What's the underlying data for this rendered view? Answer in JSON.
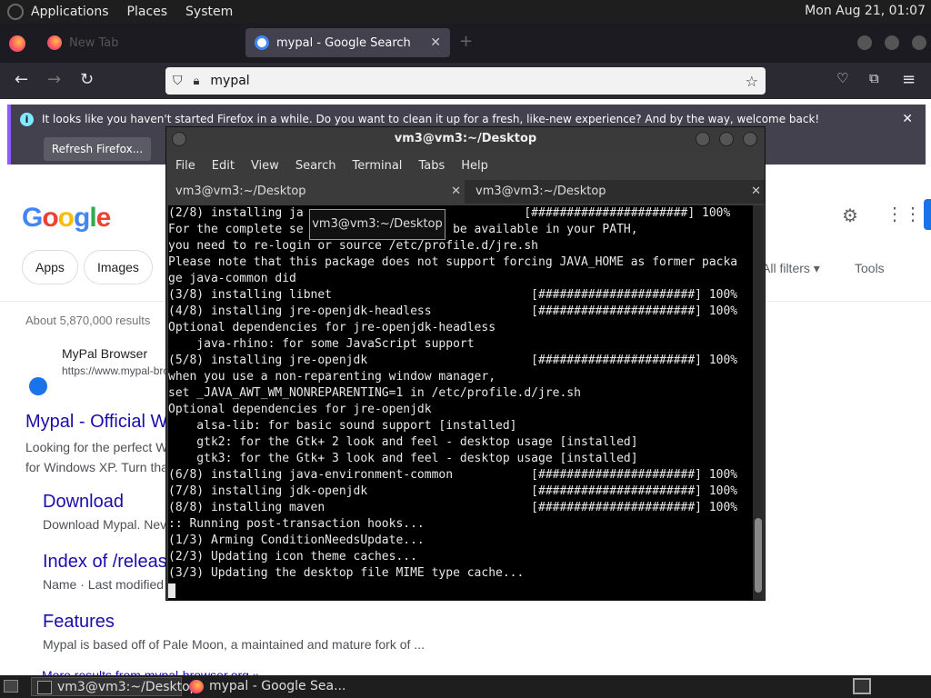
{
  "top_panel": {
    "menus": [
      "Applications",
      "Places",
      "System"
    ],
    "clock": "Mon Aug 21, 01:07"
  },
  "firefox": {
    "tabs": [
      {
        "label": "New Tab",
        "active": false
      },
      {
        "label": "mypal - Google Search",
        "active": true
      }
    ],
    "url": "mypal",
    "notification": {
      "message": "It looks like you haven't started Firefox in a while. Do you want to clean it up for a fresh, like-new experience? And by the way, welcome back!",
      "button": "Refresh Firefox..."
    }
  },
  "google": {
    "logo": "Google",
    "chips": [
      "Apps",
      "Images"
    ],
    "all_filters": "All filters",
    "tools": "Tools",
    "result_count": "About 5,870,000 results",
    "result": {
      "site_name": "MyPal Browser",
      "site_url": "https://www.mypal-bro",
      "title": "Mypal - Official W",
      "snippet_line1": "Looking for the perfect W",
      "snippet_line2": "for Windows XP. Turn tha"
    },
    "sublinks": [
      {
        "title": "Download",
        "snippet": "Download Mypal. Nev"
      },
      {
        "title": "Index of /releas",
        "snippet": "Name · Last modified"
      },
      {
        "title": "Features",
        "snippet": "Mypal is based off of Pale Moon, a maintained and mature fork of ..."
      }
    ],
    "more_results": "More results from mypal-browser.org »"
  },
  "terminal": {
    "title": "vm3@vm3:~/Desktop",
    "menus": [
      "File",
      "Edit",
      "View",
      "Search",
      "Terminal",
      "Tabs",
      "Help"
    ],
    "tabs": [
      "vm3@vm3:~/Desktop",
      "vm3@vm3:~/Desktop"
    ],
    "tooltip": "vm3@vm3:~/Desktop",
    "output": "(2/8) installing ja                               [######################] 100%\nFor the complete se                  to be available in your PATH,\nyou need to re-login or source /etc/profile.d/jre.sh\nPlease note that this package does not support forcing JAVA_HOME as former packa\nge java-common did\n(3/8) installing libnet                            [######################] 100%\n(4/8) installing jre-openjdk-headless              [######################] 100%\nOptional dependencies for jre-openjdk-headless\n    java-rhino: for some JavaScript support\n(5/8) installing jre-openjdk                       [######################] 100%\nwhen you use a non-reparenting window manager,\nset _JAVA_AWT_WM_NONREPARENTING=1 in /etc/profile.d/jre.sh\nOptional dependencies for jre-openjdk\n    alsa-lib: for basic sound support [installed]\n    gtk2: for the Gtk+ 2 look and feel - desktop usage [installed]\n    gtk3: for the Gtk+ 3 look and feel - desktop usage [installed]\n(6/8) installing java-environment-common           [######################] 100%\n(7/8) installing jdk-openjdk                       [######################] 100%\n(8/8) installing maven                             [######################] 100%\n:: Running post-transaction hooks...\n(1/3) Arming ConditionNeedsUpdate...\n(2/3) Updating icon theme caches...\n(3/3) Updating the desktop file MIME type cache..."
  },
  "taskbar": {
    "tasks": [
      "vm3@vm3:~/Desktop",
      "mypal - Google Sea..."
    ]
  }
}
